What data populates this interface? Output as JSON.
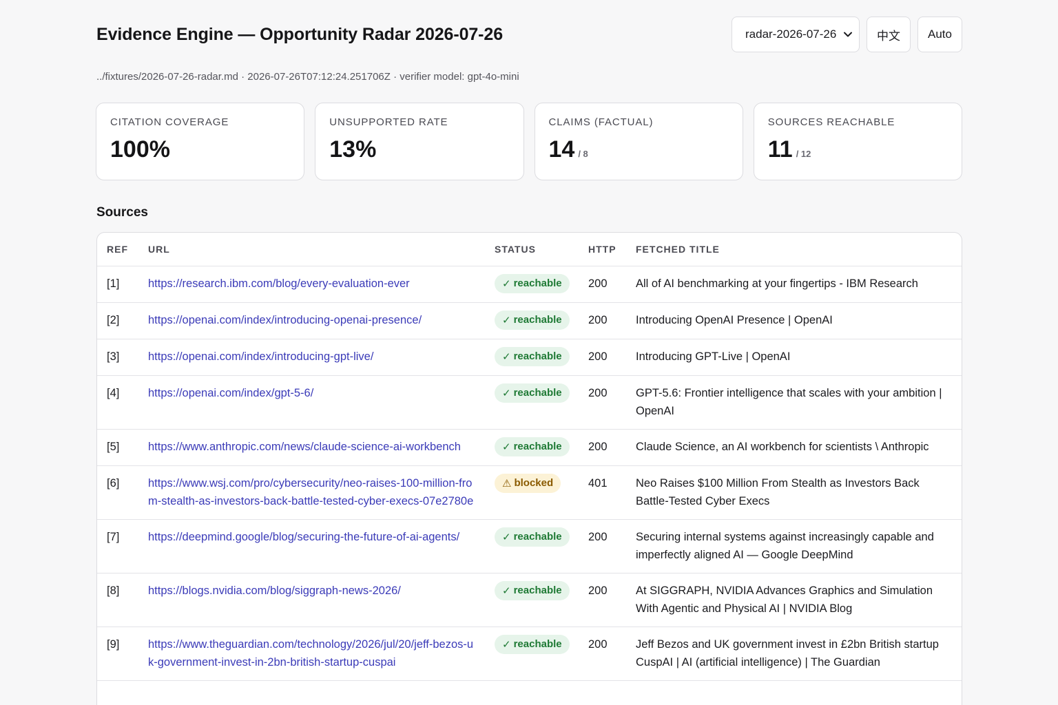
{
  "header": {
    "title": "Evidence Engine — Opportunity Radar 2026-07-26",
    "report_select": {
      "selected": "radar-2026-07-26"
    },
    "lang_button": "中文",
    "theme_button": "Auto"
  },
  "meta_line": "../fixtures/2026-07-26-radar.md · 2026-07-26T07:12:24.251706Z · verifier model: gpt-4o-mini",
  "metrics": [
    {
      "label": "Citation coverage",
      "value": "100%",
      "sub": ""
    },
    {
      "label": "Unsupported rate",
      "value": "13%",
      "sub": ""
    },
    {
      "label": "Claims (factual)",
      "value": "14",
      "sub": "/ 8"
    },
    {
      "label": "Sources reachable",
      "value": "11",
      "sub": "/ 12"
    }
  ],
  "sources": {
    "title": "Sources",
    "columns": [
      "Ref",
      "URL",
      "Status",
      "HTTP",
      "Fetched title"
    ],
    "rows": [
      {
        "ref": "[1]",
        "url": "https://research.ibm.com/blog/every-evaluation-ever",
        "status": "reachable",
        "status_glyph": "✓",
        "http": "200",
        "title": "All of AI benchmarking at your fingertips - IBM Research"
      },
      {
        "ref": "[2]",
        "url": "https://openai.com/index/introducing-openai-presence/",
        "status": "reachable",
        "status_glyph": "✓",
        "http": "200",
        "title": "Introducing OpenAI Presence | OpenAI"
      },
      {
        "ref": "[3]",
        "url": "https://openai.com/index/introducing-gpt-live/",
        "status": "reachable",
        "status_glyph": "✓",
        "http": "200",
        "title": "Introducing GPT-Live | OpenAI"
      },
      {
        "ref": "[4]",
        "url": "https://openai.com/index/gpt-5-6/",
        "status": "reachable",
        "status_glyph": "✓",
        "http": "200",
        "title": "GPT-5.6: Frontier intelligence that scales with your ambition | OpenAI"
      },
      {
        "ref": "[5]",
        "url": "https://www.anthropic.com/news/claude-science-ai-workbench",
        "status": "reachable",
        "status_glyph": "✓",
        "http": "200",
        "title": "Claude Science, an AI workbench for scientists \\ Anthropic"
      },
      {
        "ref": "[6]",
        "url": "https://www.wsj.com/pro/cybersecurity/neo-raises-100-million-from-stealth-as-investors-back-battle-tested-cyber-execs-07e2780e",
        "status": "blocked",
        "status_glyph": "⚠",
        "http": "401",
        "title": "Neo Raises $100 Million From Stealth as Investors Back Battle-Tested Cyber Execs"
      },
      {
        "ref": "[7]",
        "url": "https://deepmind.google/blog/securing-the-future-of-ai-agents/",
        "status": "reachable",
        "status_glyph": "✓",
        "http": "200",
        "title": "Securing internal systems against increasingly capable and imperfectly aligned AI — Google DeepMind"
      },
      {
        "ref": "[8]",
        "url": "https://blogs.nvidia.com/blog/siggraph-news-2026/",
        "status": "reachable",
        "status_glyph": "✓",
        "http": "200",
        "title": "At SIGGRAPH, NVIDIA Advances Graphics and Simulation With Agentic and Physical AI | NVIDIA Blog"
      },
      {
        "ref": "[9]",
        "url": "https://www.theguardian.com/technology/2026/jul/20/jeff-bezos-uk-government-invest-in-2bn-british-startup-cuspai",
        "status": "reachable",
        "status_glyph": "✓",
        "http": "200",
        "title": "Jeff Bezos and UK government invest in £2bn British startup CuspAI | AI (artificial intelligence) | The Guardian"
      }
    ]
  },
  "colors": {
    "link": "#3b3bb8",
    "reachable_bg": "#e6f4ea",
    "reachable_fg": "#1f7a35",
    "blocked_bg": "#fcf2d6",
    "blocked_fg": "#8a5a00"
  }
}
